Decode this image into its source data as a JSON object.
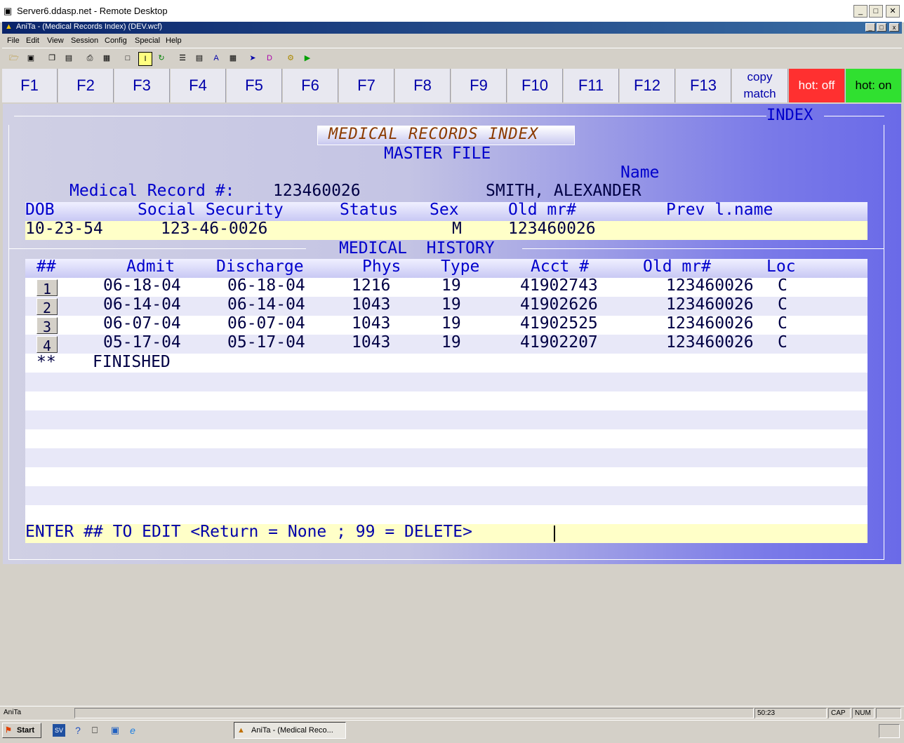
{
  "window": {
    "title": "Server6.ddasp.net - Remote Desktop",
    "app_title": "AniTa - (Medical Records Index) (DEV.wcf)"
  },
  "menu": [
    "File",
    "Edit",
    "View",
    "Session",
    "Config",
    "Special",
    "Help"
  ],
  "fkeys": [
    "F1",
    "F2",
    "F3",
    "F4",
    "F5",
    "F6",
    "F7",
    "F8",
    "F9",
    "F10",
    "F11",
    "F12",
    "F13"
  ],
  "copy_match": {
    "line1": "copy",
    "line2": "match"
  },
  "hot_off": "hot: off",
  "hot_on": "hot: on",
  "screen": {
    "index_label": "INDEX",
    "title": "MEDICAL RECORDS INDEX",
    "subtitle": "MASTER FILE",
    "name_label": "Name",
    "mr_label": "Medical Record #:",
    "mr_value": "123460026",
    "patient_name": "SMITH, ALEXANDER",
    "demo_headers": {
      "dob": "DOB",
      "ssn": "Social Security",
      "status": "Status",
      "sex": "Sex",
      "old_mr": "Old mr#",
      "prev_lname": "Prev l.name"
    },
    "demo_values": {
      "dob": "10-23-54",
      "ssn": "123-46-0026",
      "sex": "M",
      "old_mr": "123460026"
    },
    "history_title": "MEDICAL  HISTORY",
    "history_headers": {
      "num": "##",
      "admit": "Admit",
      "discharge": "Discharge",
      "phys": "Phys",
      "type": "Type",
      "acct": "Acct #",
      "old_mr": "Old mr#",
      "loc": "Loc"
    },
    "history_rows": [
      {
        "num": "1",
        "admit": "06-18-04",
        "discharge": "06-18-04",
        "phys": "1216",
        "type": "19",
        "acct": "41902743",
        "old_mr": "123460026",
        "loc": "C"
      },
      {
        "num": "2",
        "admit": "06-14-04",
        "discharge": "06-14-04",
        "phys": "1043",
        "type": "19",
        "acct": "41902626",
        "old_mr": "123460026",
        "loc": "C"
      },
      {
        "num": "3",
        "admit": "06-07-04",
        "discharge": "06-07-04",
        "phys": "1043",
        "type": "19",
        "acct": "41902525",
        "old_mr": "123460026",
        "loc": "C"
      },
      {
        "num": "4",
        "admit": "05-17-04",
        "discharge": "05-17-04",
        "phys": "1043",
        "type": "19",
        "acct": "41902207",
        "old_mr": "123460026",
        "loc": "C"
      }
    ],
    "finished_marker": "**",
    "finished_text": "FINISHED",
    "prompt": "ENTER ## TO EDIT <Return = None ; 99 = DELETE>"
  },
  "statusbar": {
    "app": "AniTa",
    "time": "50:23",
    "cap": "CAP",
    "num": "NUM"
  },
  "taskbar": {
    "start": "Start",
    "task": "AniTa - (Medical Reco..."
  }
}
